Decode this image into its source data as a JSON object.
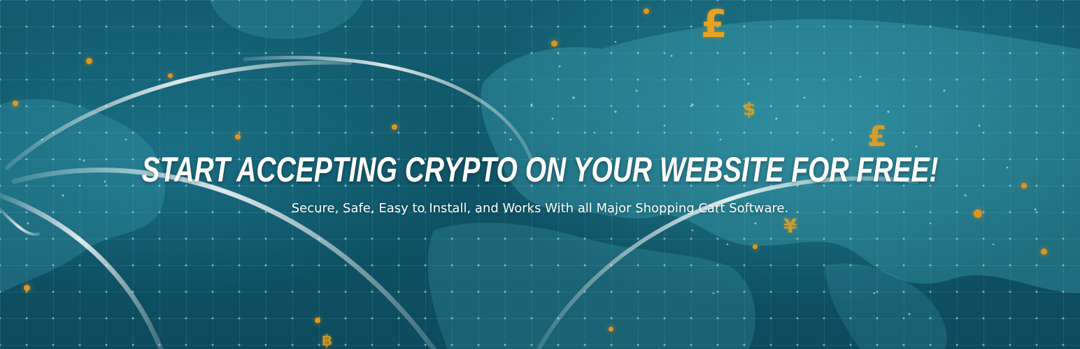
{
  "hero": {
    "headline": "START ACCEPTING CRYPTO ON YOUR WEBSITE FOR FREE!",
    "subheadline": "Secure, Safe, Easy to Install, and Works With all Major Shopping Cart Software."
  },
  "currency_symbols": {
    "pound_large": "£",
    "dollar": "$",
    "pound_small": "£",
    "yen": "¥",
    "baht": "฿"
  },
  "colors": {
    "background": "#0f5668",
    "accent_gold": "#e8a21e",
    "text": "#ffffff"
  }
}
